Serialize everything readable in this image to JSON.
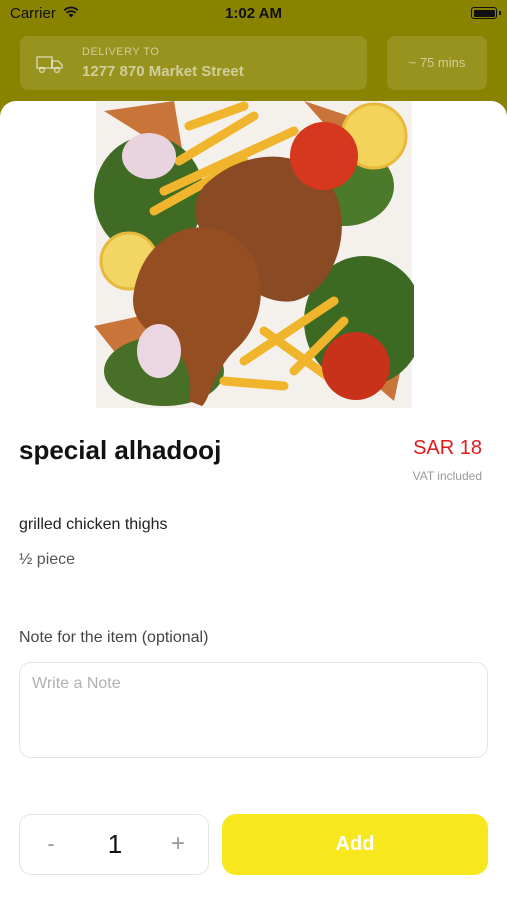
{
  "status_bar": {
    "carrier": "Carrier",
    "time": "1:02 AM"
  },
  "header": {
    "delivery_label": "DELIVERY TO",
    "address": "1277 870 Market Street",
    "eta": "~ 75 mins"
  },
  "item": {
    "name": "special alhadooj",
    "price": "SAR 18",
    "vat_note": "VAT included",
    "description": "grilled chicken thighs",
    "portion": "½ piece"
  },
  "note": {
    "label": "Note for the item (optional)",
    "placeholder": "Write a Note",
    "value": ""
  },
  "order": {
    "minus_label": "-",
    "quantity": "1",
    "plus_label": "+",
    "add_label": "Add"
  },
  "colors": {
    "accent_yellow": "#f7e71c",
    "price_red": "#e01a1a",
    "overlay_olive": "#8a8300"
  },
  "icons": [
    "wifi-icon",
    "battery-icon",
    "delivery-truck-icon",
    "chevron-down-icon"
  ]
}
